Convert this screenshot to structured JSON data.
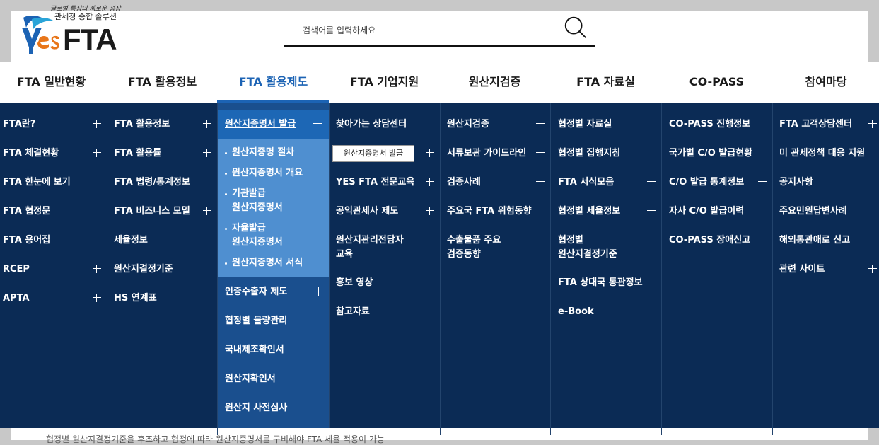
{
  "logo": {
    "tagline_script": "글로벌 통상의 새로운 성장",
    "tagline": "관세청 종합 솔루션",
    "brand": "FTA",
    "brand_prefix": "yes"
  },
  "search": {
    "placeholder": "검색어를 입력하세요"
  },
  "gnb": [
    "FTA 일반현황",
    "FTA 활용정보",
    "FTA 활용제도",
    "FTA 기업지원",
    "원산지검증",
    "FTA 자료실",
    "CO-PASS",
    "참여마당"
  ],
  "menu": {
    "col1": [
      {
        "label": "FTA란?",
        "plus": true
      },
      {
        "label": "FTA 체결현황",
        "plus": true
      },
      {
        "label": "FTA 한눈에 보기",
        "plus": false
      },
      {
        "label": "FTA 협정문",
        "plus": false
      },
      {
        "label": "FTA 용어집",
        "plus": false
      },
      {
        "label": "RCEP",
        "plus": true
      },
      {
        "label": "APTA",
        "plus": true
      }
    ],
    "col2": [
      {
        "label": "FTA 활용정보",
        "plus": true
      },
      {
        "label": "FTA 활용률",
        "plus": true
      },
      {
        "label": "FTA 법령/통계정보",
        "plus": false
      },
      {
        "label": "FTA 비즈니스 모델",
        "plus": true
      },
      {
        "label": "세율정보",
        "plus": false
      },
      {
        "label": "원산지결정기준",
        "plus": false
      },
      {
        "label": "HS 연계표",
        "plus": false
      }
    ],
    "col3": {
      "head": "원산지증명서 발급",
      "sub": [
        "원산지증명 절차",
        "원산지증명서 개요",
        "기관발급",
        "원산지증명서",
        "자율발급",
        "원산지증명서",
        "원산지증명서 서식"
      ],
      "rest": [
        {
          "label": "인증수출자 제도",
          "plus": true
        },
        {
          "label": "협정별 물량관리",
          "plus": false
        },
        {
          "label": "국내제조확인서",
          "plus": false
        },
        {
          "label": "원산지확인서",
          "plus": false
        },
        {
          "label": "원산지 사전심사",
          "plus": false
        }
      ]
    },
    "col4": [
      {
        "label": "찾아가는 상담센터",
        "plus": false
      },
      {
        "label": "",
        "plus": true
      },
      {
        "label": "YES FTA 전문교육",
        "plus": true
      },
      {
        "label": "공익관세사 제도",
        "plus": true
      },
      {
        "label": "원산지관리전담자",
        "label2": "교육",
        "plus": false
      },
      {
        "label": "홍보 영상",
        "plus": false
      },
      {
        "label": "참고자료",
        "plus": false
      }
    ],
    "col5": [
      {
        "label": "원산지검증",
        "plus": true
      },
      {
        "label": "서류보관 가이드라인",
        "plus": true
      },
      {
        "label": "검증사례",
        "plus": true
      },
      {
        "label": "주요국 FTA 위험동향",
        "plus": false
      },
      {
        "label": "수출물품 주요",
        "label2": "검증동향",
        "plus": false
      }
    ],
    "col6": [
      {
        "label": "협정별 자료실",
        "plus": false
      },
      {
        "label": "협정별 집행지침",
        "plus": false
      },
      {
        "label": "FTA 서식모음",
        "plus": true
      },
      {
        "label": "협정별 세율정보",
        "plus": true
      },
      {
        "label": "협정별",
        "label2": "원산지결정기준",
        "plus": false
      },
      {
        "label": "FTA 상대국 통관정보",
        "plus": false
      },
      {
        "label": "e-Book",
        "plus": true
      }
    ],
    "col7": [
      {
        "label": "CO-PASS 진행정보",
        "plus": false
      },
      {
        "label": "국가별 C/O 발급현황",
        "plus": false
      },
      {
        "label": "C/O 발급 통계정보",
        "plus": true
      },
      {
        "label": "자사 C/O 발급이력",
        "plus": false
      },
      {
        "label": "CO-PASS 장애신고",
        "plus": false
      }
    ],
    "col8": [
      {
        "label": "FTA 고객상담센터",
        "plus": true
      },
      {
        "label": "미 관세정책 대응 지원",
        "plus": false
      },
      {
        "label": "공지사항",
        "plus": false
      },
      {
        "label": "주요민원답변사례",
        "plus": false
      },
      {
        "label": "해외통관애로 신고",
        "plus": false
      },
      {
        "label": "관련 사이트",
        "plus": true
      }
    ]
  },
  "tooltip": "원산지증명서 발급",
  "bottom_text": "협정별 원산지결정기준을 후조하고 협정에 따라 원산지증명서를 구비해야 FTA 세율 적용이 가능"
}
